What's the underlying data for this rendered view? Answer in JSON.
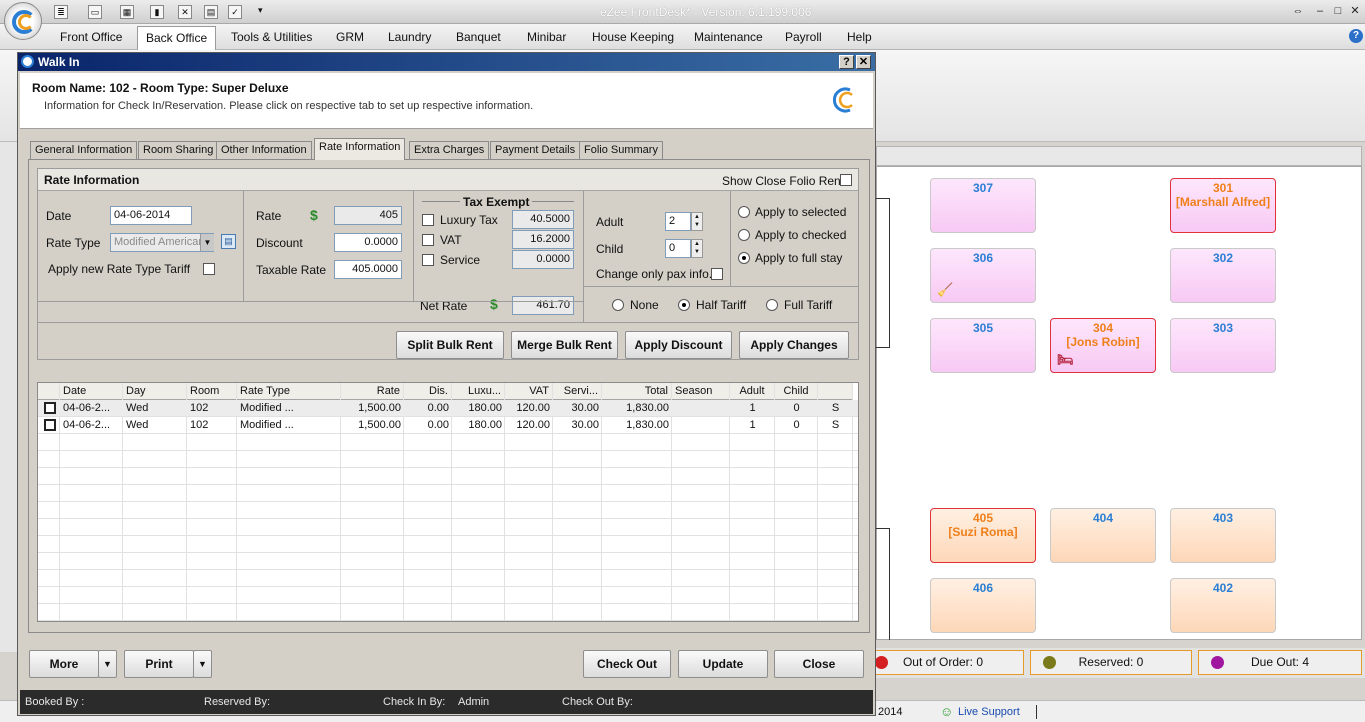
{
  "app": {
    "title": "eZee FrontDesk* - Version: 6.1.199.006",
    "window_controls": {
      "restore": "⇔",
      "minimize": "–",
      "maximize": "□",
      "close": "✕"
    }
  },
  "menu": [
    "Front Office",
    "Back Office",
    "Tools & Utilities",
    "GRM",
    "Laundry",
    "Banquet",
    "Minibar",
    "House Keeping",
    "Maintenance",
    "Payroll",
    "Help"
  ],
  "menu_active": "Back Office",
  "rooms": [
    {
      "num": "307",
      "guest": "",
      "theme": "pink",
      "occupied": false,
      "icon": ""
    },
    {
      "num": "301",
      "guest": "[Marshall Alfred]",
      "theme": "pink",
      "occupied": true,
      "icon": ""
    },
    {
      "num": "306",
      "guest": "",
      "theme": "pink",
      "occupied": false,
      "icon": "broom-icon"
    },
    {
      "num": "302",
      "guest": "",
      "theme": "pink",
      "occupied": false,
      "icon": ""
    },
    {
      "num": "305",
      "guest": "",
      "theme": "pink",
      "occupied": false,
      "icon": ""
    },
    {
      "num": "304",
      "guest": "[Jons Robin]",
      "theme": "pink",
      "occupied": true,
      "icon": "bed-icon"
    },
    {
      "num": "303",
      "guest": "",
      "theme": "pink",
      "occupied": false,
      "icon": ""
    },
    {
      "num": "405",
      "guest": "[Suzi Roma]",
      "theme": "peach",
      "occupied": true,
      "icon": ""
    },
    {
      "num": "404",
      "guest": "",
      "theme": "peach",
      "occupied": false,
      "icon": ""
    },
    {
      "num": "403",
      "guest": "",
      "theme": "peach",
      "occupied": false,
      "icon": ""
    },
    {
      "num": "406",
      "guest": "",
      "theme": "peach",
      "occupied": false,
      "icon": ""
    },
    {
      "num": "402",
      "guest": "",
      "theme": "peach",
      "occupied": false,
      "icon": ""
    }
  ],
  "status": {
    "out_of_order": "Out of Order: 0",
    "reserved": "Reserved: 0",
    "due_out": "Due Out: 4"
  },
  "status_colors": {
    "out_of_order": "#d42020",
    "reserved": "#7a7a1a",
    "due_out": "#a0169e"
  },
  "bottom_bar": {
    "year": "2014",
    "live_support": "Live Support"
  },
  "dialog": {
    "title": "Walk In",
    "title_buttons": {
      "help": "?",
      "close": "✕"
    },
    "room_heading": "Room Name: 102 - Room Type: Super Deluxe",
    "room_sub": "Information for Check In/Reservation. Please click on respective tab to set up respective information.",
    "tabs": [
      "General Information",
      "Room Sharing",
      "Other Information",
      "Rate Information",
      "Extra Charges",
      "Payment Details",
      "Folio Summary"
    ],
    "active_tab": "Rate Information",
    "rate": {
      "section_title": "Rate Information",
      "show_close_folio_rent": "Show Close Folio Rent",
      "date_label": "Date",
      "date_value": "04-06-2014",
      "rate_type_label": "Rate Type",
      "rate_type_value": "Modified American",
      "apply_new_tariff": "Apply new Rate Type Tariff",
      "rate_label": "Rate",
      "rate_value": "405",
      "discount_label": "Discount",
      "discount_value": "0.0000",
      "taxable_label": "Taxable Rate",
      "taxable_value": "405.0000",
      "tax_exempt_title": "Tax Exempt",
      "luxury_tax_label": "Luxury Tax",
      "luxury_tax_value": "40.5000",
      "vat_label": "VAT",
      "vat_value": "16.2000",
      "service_label": "Service",
      "service_value": "0.0000",
      "net_rate_label": "Net Rate",
      "net_rate_value": "461.70",
      "adult_label": "Adult",
      "adult_value": "2",
      "child_label": "Child",
      "child_value": "0",
      "change_pax": "Change only pax info.",
      "apply_selected": "Apply to selected",
      "apply_checked": "Apply to checked",
      "apply_full_stay": "Apply to full stay",
      "tariff_none": "None",
      "tariff_half": "Half Tariff",
      "tariff_full": "Full Tariff",
      "split_bulk_rent": "Split Bulk Rent",
      "merge_bulk_rent": "Merge Bulk Rent",
      "apply_discount": "Apply Discount",
      "apply_changes": "Apply Changes"
    },
    "grid": {
      "columns": [
        "",
        "Date",
        "Day",
        "Room",
        "Rate Type",
        "Rate",
        "Dis.",
        "Luxu...",
        "VAT",
        "Servi...",
        "Total",
        "Season",
        "Adult",
        "Child",
        ""
      ],
      "rows": [
        [
          "",
          "04-06-2...",
          "Wed",
          "102",
          "Modified ...",
          "1,500.00",
          "0.00",
          "180.00",
          "120.00",
          "30.00",
          "1,830.00",
          "",
          "1",
          "0",
          "S"
        ],
        [
          "",
          "04-06-2...",
          "Wed",
          "102",
          "Modified ...",
          "1,500.00",
          "0.00",
          "180.00",
          "120.00",
          "30.00",
          "1,830.00",
          "",
          "1",
          "0",
          "S"
        ]
      ]
    },
    "buttons": {
      "more": "More",
      "print": "Print",
      "check_out": "Check Out",
      "update": "Update",
      "close": "Close"
    },
    "footer": {
      "booked_by": "Booked By :",
      "reserved_by": "Reserved By:",
      "check_in_by": "Check In By:",
      "check_in_by_value": "Admin",
      "check_out_by": "Check Out By:"
    }
  }
}
